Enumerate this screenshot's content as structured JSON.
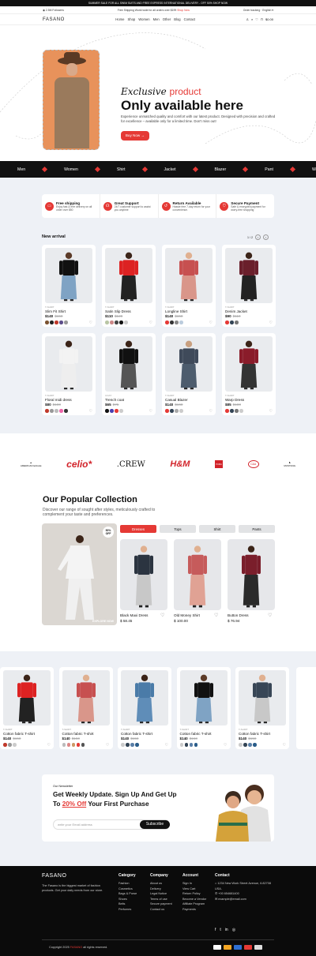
{
  "topbar": {
    "text": "SUMMER SALE FOR ALL SWIM SUITS AND FREE EXPRESS INTERNATIONAL DELIVERY - OFF 50% SHOP NOW"
  },
  "infobar": {
    "followers": "2.5M Followers",
    "promo": "Free Shipping World wide for all orders over $199",
    "promo_link": "Shop Now",
    "tracking": "Order tracking",
    "lang": "English"
  },
  "header": {
    "logo": "FASANO",
    "nav": [
      "Home",
      "Shop",
      "Women",
      "Men",
      "Other",
      "Blog",
      "Contact"
    ],
    "cart_total": "$0.00"
  },
  "hero": {
    "eyebrow_italic": "Exclusive",
    "eyebrow_accent": "product",
    "title": "Only available here",
    "description": "Experience unmatched quality and comfort with our latest product. Designed with precision and crafted for excellence – available only for a limited time. Don't miss out!",
    "cta": "Buy Now"
  },
  "marquee": [
    "Men",
    "Women",
    "Shirt",
    "Jacket",
    "Blazer",
    "Pant",
    "Wallet"
  ],
  "features": [
    {
      "title": "Free shipping",
      "desc": "Enjoy fast & free delivery on all order over $50",
      "icon": "truck-icon"
    },
    {
      "title": "Great Support",
      "desc": "24/7 customer support to assist you anytime",
      "icon": "headset-icon"
    },
    {
      "title": "Return Available",
      "desc": "Hassle free 7-day return for your convenience.",
      "icon": "return-icon"
    },
    {
      "title": "Secure Payment",
      "desc": "Safe & encrypted payment for worry-free shopping",
      "icon": "shield-icon"
    }
  ],
  "new_arrival": {
    "title": "New arrival",
    "pager": "1 / 2",
    "products": [
      {
        "cat": "T-SHIRT",
        "name": "Slim Fit Shirt",
        "price": "$140",
        "old": "$150",
        "colors": [
          "#7a5230",
          "#222",
          "#c0392b",
          "#5d4e8a",
          "#999"
        ],
        "top": "#111",
        "bottom": "#7fa3c4",
        "skin": "#5c3b28"
      },
      {
        "cat": "T-SHIRT",
        "name": "Satin Slip Dress",
        "price": "$110",
        "old": "$120",
        "colors": [
          "#b9c6a5",
          "#c88",
          "#444",
          "#111",
          "#ccc"
        ],
        "top": "#d22",
        "bottom": "#222",
        "skin": "#3b2418"
      },
      {
        "cat": "T-SHIRT",
        "name": "Longline Shirt",
        "price": "$140",
        "old": "$150",
        "colors": [
          "#e53935",
          "#333",
          "#888",
          "#bcd"
        ],
        "top": "#c75050",
        "bottom": "#d9968a",
        "skin": "#e0b090"
      },
      {
        "cat": "T-SHIRT",
        "name": "Denim Jacket",
        "price": "$90",
        "old": "$110",
        "colors": [
          "#e53935",
          "#345",
          "#777"
        ],
        "top": "#6a1f2b",
        "bottom": "#222",
        "skin": "#3b2418"
      },
      {
        "cat": "T-SHIRT",
        "name": "Floral midi dress",
        "price": "$80",
        "old": "$100",
        "colors": [
          "#c0392b",
          "#999",
          "#bbb",
          "#e6a",
          "#333"
        ],
        "top": "#f3f3f3",
        "bottom": "#eee",
        "skin": "#3b2418"
      },
      {
        "cat": "COAT",
        "name": "Trench coat",
        "price": "$65",
        "old": "$75",
        "colors": [
          "#111",
          "#4a3fb0",
          "#e53935",
          "#ccc"
        ],
        "top": "#111",
        "bottom": "#555",
        "skin": "#3b2418"
      },
      {
        "cat": "T-SHIRT",
        "name": "Casual Blazer",
        "price": "$140",
        "old": "$160",
        "colors": [
          "#e53935",
          "#345",
          "#aaa",
          "#ccc"
        ],
        "top": "#3f4a5a",
        "bottom": "#4d5c6d",
        "skin": "#c9a080"
      },
      {
        "cat": "T-SHIRT",
        "name": "Warp Dress",
        "price": "$85",
        "old": "$100",
        "colors": [
          "#e53935",
          "#345",
          "#777",
          "#ccc"
        ],
        "top": "#8a1c2a",
        "bottom": "#333",
        "skin": "#3b2418"
      }
    ]
  },
  "brands": [
    "AMERICAN EAGLE",
    "celio*",
    ".CREW",
    "H&M",
    "PUMA",
    "C&A",
    "MUSTANG"
  ],
  "collection": {
    "title": "Our Popular Collection",
    "subtitle": "Discover our range of sought after styles, meticulously crafted to complement your taste and preferences.",
    "tabs": [
      "Dresses",
      "Tops",
      "Shirt",
      "Pants"
    ],
    "badge_pct": "50%",
    "badge_off": "OFF",
    "explore": "EXPLORE NOW",
    "products": [
      {
        "name": "Black Maxi Dress",
        "price": "$ 58.45",
        "top": "#2b3440",
        "bottom": "#c8c8c8",
        "skin": "#e0b090"
      },
      {
        "name": "Old Money Shirt",
        "price": "$ 100.00",
        "top": "#c65b5b",
        "bottom": "#e0a294",
        "skin": "#e0b090"
      },
      {
        "name": "Button Dress",
        "price": "$ 76.94",
        "top": "#7a1e2b",
        "bottom": "#2a2a2a",
        "skin": "#3b2418"
      }
    ]
  },
  "slider": [
    {
      "cat": "T-SHIRT",
      "name": "Cotton fabric T-shirt",
      "price": "$140",
      "old": "$150",
      "colors": [
        "#c0392b",
        "#999",
        "#ccc"
      ],
      "top": "#d22",
      "bottom": "#222",
      "skin": "#3b2418"
    },
    {
      "cat": "T-SHIRT",
      "name": "Cotton fabric T-shirt",
      "price": "$140",
      "old": "$150",
      "colors": [
        "#bbb",
        "#d88",
        "#c96",
        "#e53935",
        "#555"
      ],
      "top": "#c75050",
      "bottom": "#d9968a",
      "skin": "#e0b090"
    },
    {
      "cat": "T-SHIRT",
      "name": "Cotton fabric T-shirt",
      "price": "$140",
      "old": "$150",
      "colors": [
        "#ccc",
        "#345",
        "#5a7fa8",
        "#2a5d8a"
      ],
      "top": "#4a7ba8",
      "bottom": "#5f8db8",
      "skin": "#3b2418"
    },
    {
      "cat": "T-SHIRT",
      "name": "Cotton fabric T-shirt",
      "price": "$140",
      "old": "$150",
      "colors": [
        "#ccc",
        "#345",
        "#5a7fa8",
        "#2a5d8a"
      ],
      "top": "#111",
      "bottom": "#7fa3c4",
      "skin": "#5c3b28"
    },
    {
      "cat": "T-SHIRT",
      "name": "Cotton fabric T-shirt",
      "price": "$140",
      "old": "$150",
      "colors": [
        "#ccc",
        "#345",
        "#5a7fa8",
        "#2a5d8a"
      ],
      "top": "#384656",
      "bottom": "#c8c8c8",
      "skin": "#e0b090"
    }
  ],
  "newsletter": {
    "label": "Our Newsletter",
    "title1": "Get Weekly Update. Sign Up And Get Up",
    "title2a": "To",
    "title2b": "20% Off",
    "title2c": "Your First Purchase",
    "placeholder": "write your Email address",
    "button": "Subscribe"
  },
  "footer": {
    "logo": "FASANO",
    "about": "The Fasano is the biggest market of fashion products. Get your daily needs from our store.",
    "category_title": "Category",
    "category": [
      "Fashion",
      "Cosmetics",
      "Bags & Purse",
      "Shoes",
      "Belts",
      "Perfumes"
    ],
    "company_title": "Company",
    "company": [
      "About us",
      "Delivery",
      "Legal Notice",
      "Terms of use",
      "Secure payment",
      "Contact us"
    ],
    "account_title": "Account",
    "account": [
      "Sign In",
      "View Cart",
      "Return Policy",
      "Become a Vendor",
      "Affiliate Program",
      "Payments"
    ],
    "contact_title": "Contact",
    "address": "1234 New Work Street Avenue, 6.82708 USA.",
    "phone": "+00 654681400",
    "email": "example@email.com",
    "copyright_pre": "Copyright 2025",
    "copyright_brand": "FASANO",
    "copyright_post": "all rights reserved."
  },
  "colors": {
    "accent": "#e53935",
    "dark": "#0b0b0b",
    "section_bg": "#eef1f6"
  }
}
